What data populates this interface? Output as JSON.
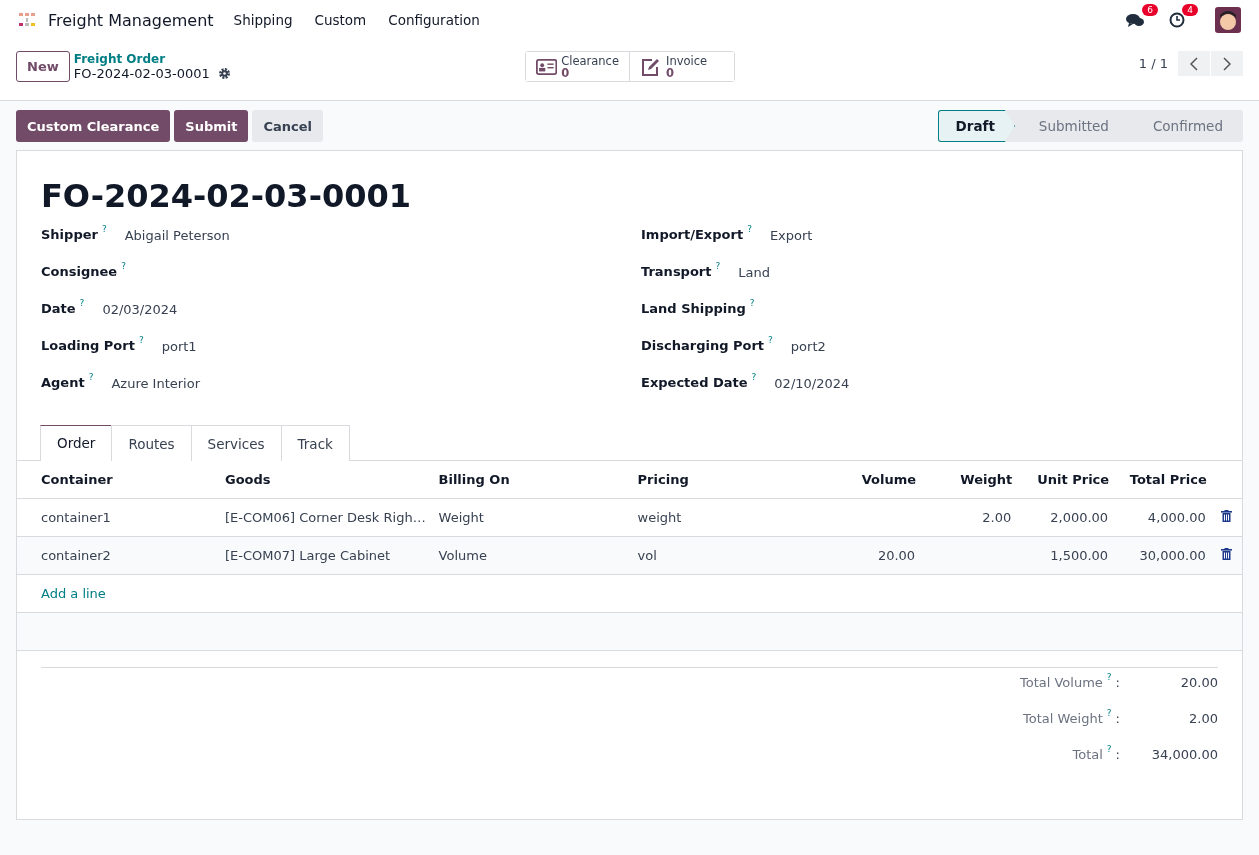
{
  "navbar": {
    "app_name": "Freight Management",
    "menus": [
      "Shipping",
      "Custom",
      "Configuration"
    ],
    "messages_count": "6",
    "activities_count": "4"
  },
  "control_panel": {
    "new_button": "New",
    "breadcrumb": "Freight Order",
    "record_name": "FO-2024-02-03-0001",
    "smart_buttons": [
      {
        "kind": "clearance",
        "label": "Clearance",
        "count": "0"
      },
      {
        "kind": "invoice",
        "label": "Invoice",
        "count": "0"
      }
    ],
    "pager": "1 / 1"
  },
  "actions": [
    {
      "label": "Custom Clearance",
      "kind": "primary"
    },
    {
      "label": "Submit",
      "kind": "primary"
    },
    {
      "label": "Cancel",
      "kind": "secondary"
    }
  ],
  "stages": [
    {
      "label": "Draft",
      "selected": true
    },
    {
      "label": "Submitted",
      "selected": false
    },
    {
      "label": "Confirmed",
      "selected": false
    }
  ],
  "title": "FO-2024-02-03-0001",
  "left_fields": [
    {
      "label": "Shipper",
      "help": "?",
      "value": "Abigail Peterson"
    },
    {
      "label": "Consignee",
      "help": "?"
    },
    {
      "label": "Date",
      "help": "?",
      "value": "02/03/2024"
    },
    {
      "label": "Loading Port",
      "help": "?",
      "value": "port1"
    },
    {
      "label": "Agent",
      "help": "?",
      "value": "Azure Interior"
    }
  ],
  "right_fields": [
    {
      "label": "Import/Export",
      "help": "?",
      "value": "Export"
    },
    {
      "label": "Transport",
      "help": "?",
      "value": "Land"
    },
    {
      "label": "Land Shipping",
      "help": "?"
    },
    {
      "label": "Discharging Port",
      "help": "?",
      "value": "port2"
    },
    {
      "label": "Expected Date",
      "help": "?",
      "value": "02/10/2024"
    }
  ],
  "tabs": [
    {
      "label": "Order",
      "selected": true
    },
    {
      "label": "Routes",
      "selected": false
    },
    {
      "label": "Services",
      "selected": false
    },
    {
      "label": "Track",
      "selected": false
    }
  ],
  "table": {
    "columns": [
      {
        "label": "Container",
        "kind": "text"
      },
      {
        "label": "Goods",
        "kind": "text"
      },
      {
        "label": "Billing On",
        "kind": "text"
      },
      {
        "label": "Pricing",
        "kind": "text"
      },
      {
        "label": "Volume",
        "kind": "number"
      },
      {
        "label": "Weight",
        "kind": "number"
      },
      {
        "label": "Unit Price",
        "kind": "number"
      },
      {
        "label": "Total Price",
        "kind": "number"
      }
    ],
    "rows": [
      {
        "cells": [
          "container1",
          "[E-COM06] Corner Desk Righ…",
          "Weight",
          "weight",
          null,
          "2.00",
          "2,000.00",
          "4,000.00"
        ]
      },
      {
        "cells": [
          "container2",
          "[E-COM07] Large Cabinet",
          "Volume",
          "vol",
          "20.00",
          null,
          "1,500.00",
          "30,000.00"
        ]
      }
    ],
    "add_line": "Add a line"
  },
  "totals": [
    {
      "label": "Total Volume",
      "help": "?",
      "separator": ":",
      "value": "20.00"
    },
    {
      "label": "Total Weight",
      "help": "?",
      "separator": ":",
      "value": "2.00"
    },
    {
      "label": "Total",
      "help": "?",
      "separator": ":",
      "value": "34,000.00"
    }
  ]
}
